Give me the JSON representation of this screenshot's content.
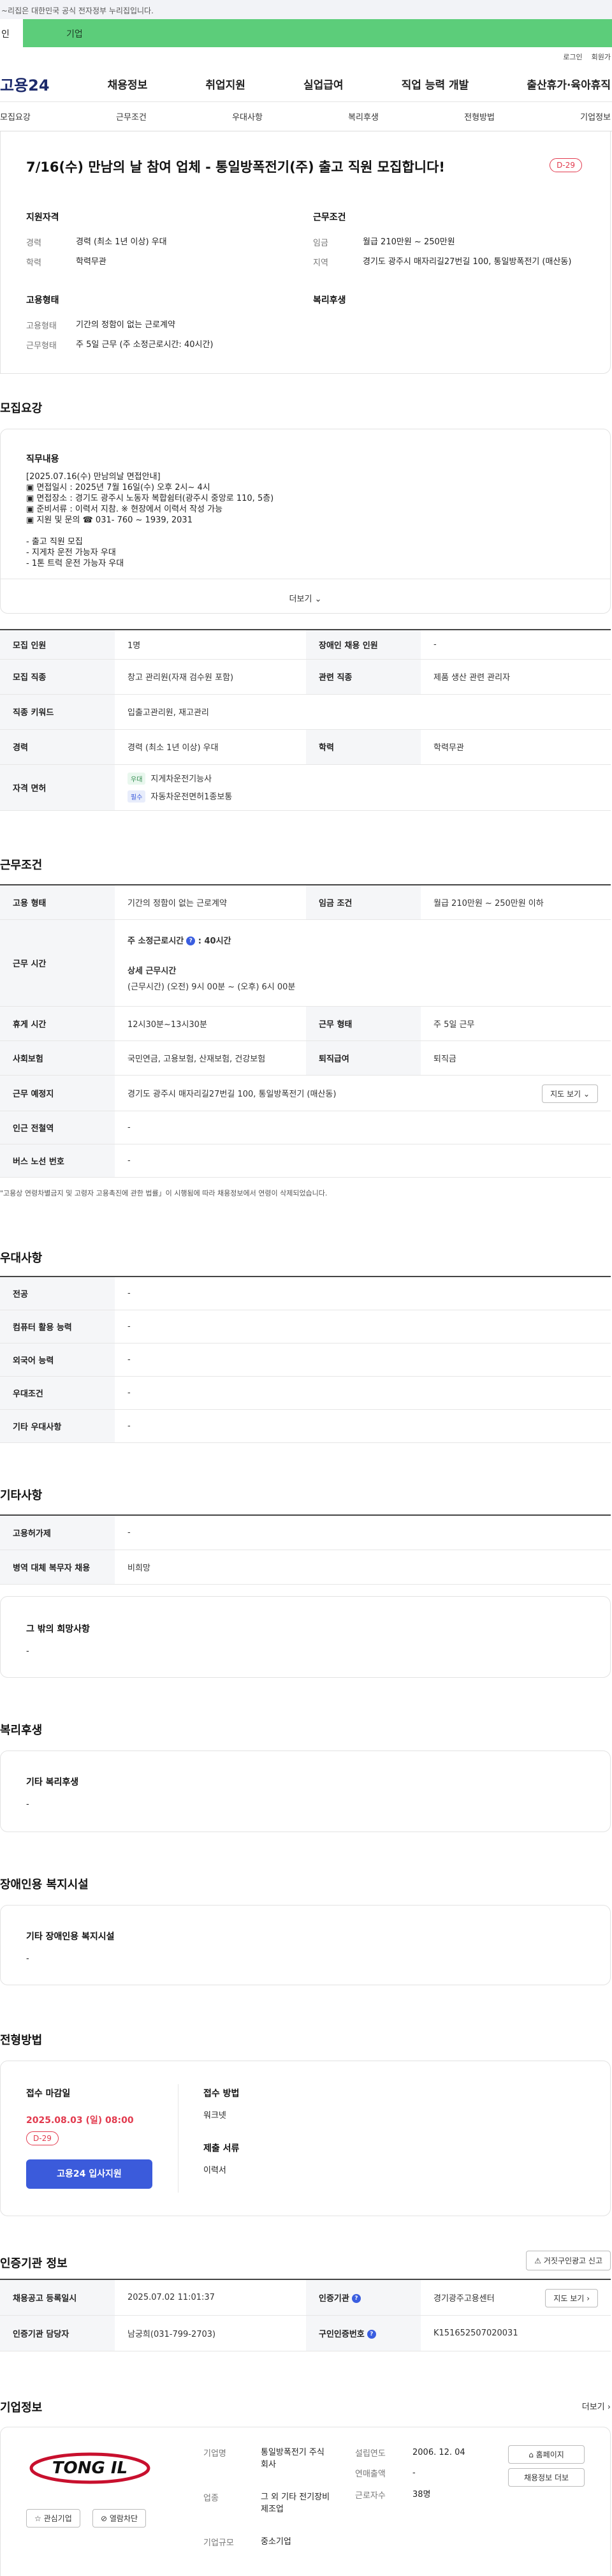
{
  "gov_notice": "~리집은 대한민국 공식 전자정부 누리집입니다.",
  "tabs": {
    "individual": "인",
    "company": "기업"
  },
  "util": {
    "login": "로그인",
    "join": "회원가"
  },
  "logo": "고용24",
  "gnb": [
    "채용정보",
    "취업지원",
    "실업급여",
    "직업 능력 개발",
    "출산휴가·육아휴직"
  ],
  "anchor_nav": [
    "모집요강",
    "근무조건",
    "우대사항",
    "복리후생",
    "전형방법",
    "기업정보"
  ],
  "job": {
    "title": "7/16(수) 만남의 날 참여 업체 - 통일방폭전기(주) 출고 직원 모집합니다!",
    "dday": "D-29",
    "qual_title": "지원자격",
    "qual": [
      {
        "k": "경력",
        "v": "경력 (최소 1년 이상) 우대"
      },
      {
        "k": "학력",
        "v": "학력무관"
      }
    ],
    "cond_title": "근무조건",
    "cond": [
      {
        "k": "임금",
        "v": "월급 210만원 ~ 250만원"
      },
      {
        "k": "지역",
        "v": "경기도 광주시 매자리길27번길 100, 통일방폭전기 (매산동)"
      }
    ],
    "emp_title": "고용형태",
    "emp": [
      {
        "k": "고용형태",
        "v": "기간의 정함이 없는 근로계약"
      },
      {
        "k": "근무형태",
        "v": "주 5일 근무 (주 소정근로시간: 40시간)"
      }
    ],
    "welfare_title": "복리후생"
  },
  "recruit": {
    "section": "모집요강",
    "duty_title": "직무내용",
    "duty_lines": [
      "[2025.07.16(수) 만남의날 면접안내]",
      "▣ 면접일시 : 2025년 7월 16일(수) 오후 2시~ 4시",
      "▣ 면접장소 : 경기도 광주시 노동자 복합쉼터(광주시 중앙로 110, 5층)",
      "▣ 준비서류 : 이력서 지참. ※ 현장에서 이력서 작성 가능",
      "▣ 지원 및 문의 ☎ 031- 760 ~ 1939, 2031",
      "",
      "- 출고 직원 모집",
      "- 지게차 운전 가능자 우대",
      "- 1톤 트럭 운전 가능자 우대"
    ],
    "more": "더보기",
    "rows": [
      {
        "k1": "모집 인원",
        "v1": "1명",
        "k2": "장애인 채용 인원",
        "v2": "-"
      },
      {
        "k1": "모집 직종",
        "v1": "창고 관리원(자재 검수원 포함)",
        "k2": "관련 직종",
        "v2": "제품 생산 관련 관리자"
      },
      {
        "k1": "직종 키워드",
        "v1": "입출고관리원, 재고관리"
      },
      {
        "k1": "경력",
        "v1": "경력 (최소 1년 이상) 우대",
        "k2": "학력",
        "v2": "학력무관"
      }
    ],
    "license_label": "자격 면허",
    "licenses": [
      {
        "tag": "우대",
        "name": "지게차운전기능사"
      },
      {
        "tag": "필수",
        "name": "자동차운전면허1종보통"
      }
    ]
  },
  "work": {
    "section": "근무조건",
    "employ_type_k": "고용 형태",
    "employ_type_v": "기간의 정함이 없는 근로계약",
    "wage_k": "임금 조건",
    "wage_v": "월급 210만원 ~ 250만원 이하",
    "hours_k": "근무 시간",
    "hours_weekly_label": "주 소정근로시간",
    "hours_weekly_val": ": 40시간",
    "hours_detail_label": "상세 근무시간",
    "hours_detail_val": "(근무시간) (오전) 9시 00분 ~ (오후) 6시 00분",
    "break_k": "휴게 시간",
    "break_v": "12시30분~13시30분",
    "worktype_k": "근무 형태",
    "worktype_v": "주 5일 근무",
    "insurance_k": "사회보험",
    "insurance_v": "국민연금, 고용보험, 산재보험, 건강보험",
    "retire_k": "퇴직급여",
    "retire_v": "퇴직금",
    "place_k": "근무 예정지",
    "place_v": "경기도 광주시 매자리길27번길 100, 통일방폭전기 (매산동)",
    "map_btn": "지도 보기",
    "subway_k": "인근 전철역",
    "subway_v": "-",
    "bus_k": "버스 노선 번호",
    "bus_v": "-",
    "note": "\"고용상 연령차별금지 및 고령자 고용촉진에 관한 법률」이 시행됨에 따라 채용정보에서 연령이 삭제되었습니다."
  },
  "pref": {
    "section": "우대사항",
    "rows": [
      {
        "k": "전공",
        "v": "-"
      },
      {
        "k": "컴퓨터 활용 능력",
        "v": "-"
      },
      {
        "k": "외국어 능력",
        "v": "-"
      },
      {
        "k": "우대조건",
        "v": "-"
      },
      {
        "k": "기타 우대사항",
        "v": "-"
      }
    ]
  },
  "etc": {
    "section": "기타사항",
    "rows": [
      {
        "k": "고용허가제",
        "v": "-"
      },
      {
        "k": "병역 대체 복무자 채용",
        "v": "비희망"
      }
    ],
    "other_title": "그 밖의 희망사항",
    "other_v": "-"
  },
  "benefit": {
    "section": "복리후생",
    "title": "기타 복리후생",
    "v": "-"
  },
  "disabled": {
    "section": "장애인용 복지시설",
    "title": "기타 장애인용 복지시설",
    "v": "-"
  },
  "screening": {
    "section": "전형방법",
    "deadline_label": "접수 마감일",
    "deadline": "2025.08.03 (일) 08:00",
    "dday": "D-29",
    "apply_btn": "고용24 입사지원",
    "method_label": "접수 방법",
    "method_v": "워크넷",
    "docs_label": "제출 서류",
    "docs_v": "이력서"
  },
  "agency": {
    "section": "인증기관 정보",
    "report_btn": "거짓구인광고 신고",
    "reg_date_k": "채용공고 등록일시",
    "reg_date_v": "2025.07.02 11:01:37",
    "cert_k": "인증기관",
    "cert_v": "경기광주고용센터",
    "map_btn": "지도 보기",
    "manager_k": "인증기관 담당자",
    "manager_v": "남궁희(031-799-2703)",
    "job_no_k": "구인인증번호",
    "job_no_v": "K151652507020031"
  },
  "company": {
    "section": "기업정보",
    "more": "더보기",
    "logo_text": "TONG IL",
    "fav_btn": "관심기업",
    "block_btn": "열람차단",
    "name_k": "기업명",
    "name_v": "통일방폭전기 주식회사",
    "industry_k": "업종",
    "industry_v": "그 외 기타 전기장비 제조업",
    "size_k": "기업규모",
    "size_v": "중소기업",
    "est_k": "설립연도",
    "est_v": "2006. 12. 04",
    "sales_k": "연매출액",
    "sales_v": "-",
    "emp_k": "근로자수",
    "emp_v": "38명",
    "home_btn": "홈페이지",
    "jobs_btn": "채용정보 더보"
  },
  "colors": {
    "accent": "#3b5bdb",
    "dday": "#e23a4e",
    "green": "#5ccd7a"
  }
}
